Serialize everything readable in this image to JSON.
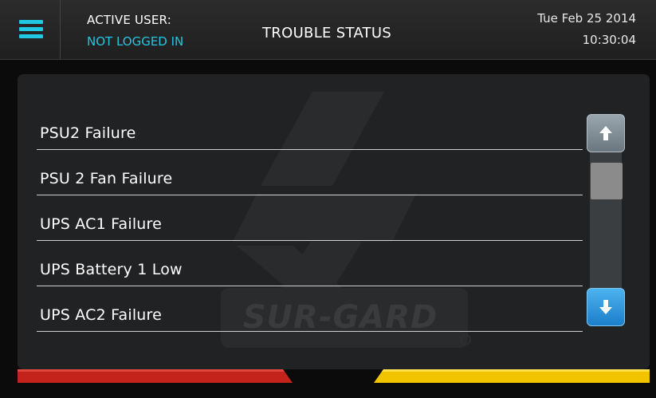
{
  "header": {
    "menu_icon": "hamburger-menu-icon",
    "active_user_label": "ACTIVE USER:",
    "active_user_value": "NOT LOGGED IN",
    "title": "TROUBLE STATUS",
    "date": "Tue Feb 25 2014",
    "time": "10:30:04"
  },
  "trouble_list": {
    "items": [
      {
        "label": "PSU2 Failure"
      },
      {
        "label": "PSU 2 Fan Failure"
      },
      {
        "label": "UPS AC1 Failure"
      },
      {
        "label": "UPS Battery 1 Low"
      },
      {
        "label": "UPS AC2 Failure"
      }
    ]
  },
  "scrollbar": {
    "up_icon": "arrow-up-icon",
    "down_icon": "arrow-down-icon"
  },
  "watermark": {
    "text": "SUR-GARD",
    "icon": "sur-gard-logo-icon"
  },
  "colors": {
    "accent": "#21c7e3",
    "trouble_bar": "#c4231c",
    "supervisory_bar": "#f2c400",
    "scroll_up_button": "#7d8991",
    "scroll_down_button": "#2b90d9"
  }
}
